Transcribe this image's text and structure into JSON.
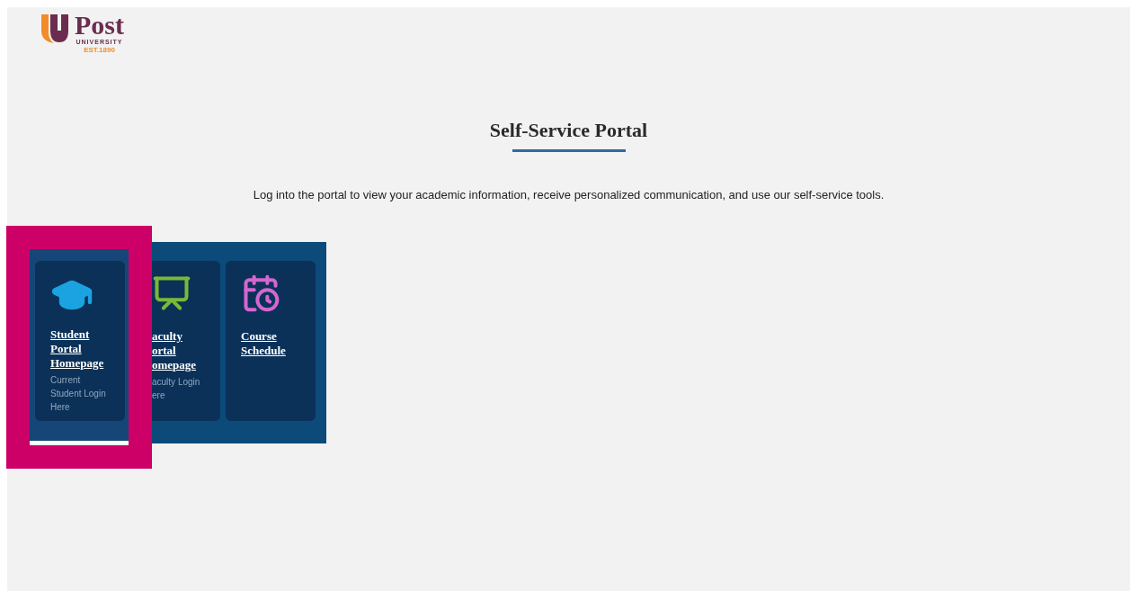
{
  "logo": {
    "name": "Post",
    "subtitle": "UNIVERSITY",
    "tagline": "EST.1890"
  },
  "title": "Self-Service Portal",
  "intro": "Log into the portal to view your academic information, receive personalized communication, and use our self-service tools.",
  "tiles": [
    {
      "kind": "student",
      "title_lines": [
        "Student",
        "Portal",
        "Homepage"
      ],
      "desc_lines": [
        "Current",
        "Student Login",
        "Here"
      ],
      "selected": true,
      "covered": false
    },
    {
      "kind": "faculty",
      "title_lines": [
        "aculty",
        "ortal",
        "omepage"
      ],
      "desc_lines": [
        "aculty Login",
        "ere"
      ],
      "selected": false,
      "covered": true
    },
    {
      "kind": "schedule",
      "title_lines": [
        "Course",
        "Schedule"
      ],
      "selected": false,
      "covered": false
    }
  ]
}
